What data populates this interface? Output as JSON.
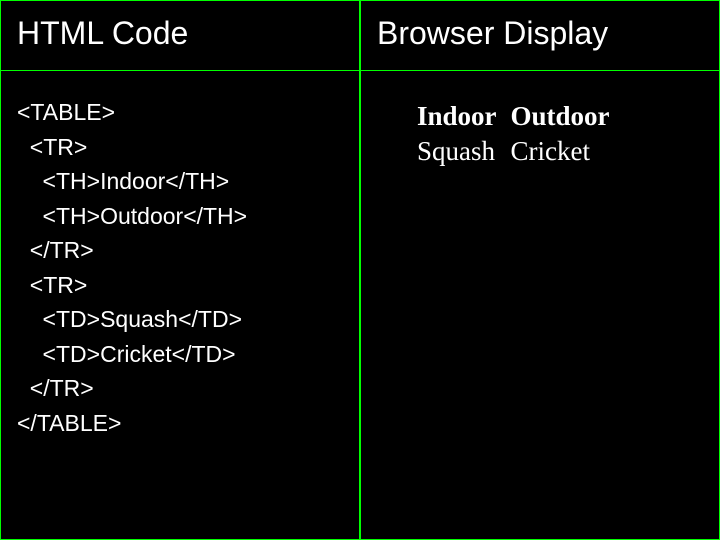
{
  "left": {
    "title": "HTML Code",
    "code": "<TABLE>\n  <TR>\n    <TH>Indoor</TH>\n    <TH>Outdoor</TH>\n  </TR>\n  <TR>\n    <TD>Squash</TD>\n    <TD>Cricket</TD>\n  </TR>\n</TABLE>"
  },
  "right": {
    "title": "Browser Display",
    "table": {
      "headers": [
        "Indoor",
        "Outdoor"
      ],
      "rows": [
        [
          "Squash",
          "Cricket"
        ]
      ]
    }
  }
}
